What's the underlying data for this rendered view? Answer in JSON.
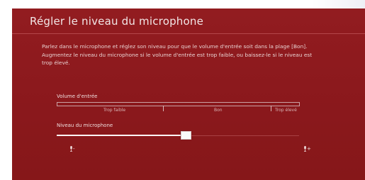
{
  "dialog": {
    "title": "Régler le niveau du microphone",
    "description": [
      "Parlez dans le microphone et réglez son niveau pour que le volume d'entrée soit dans la plage [Bon].",
      "Augmentez le niveau du microphone si le volume d'entrée est trop faible, ou baissez-le si le niveau est trop élevé."
    ]
  },
  "input_volume": {
    "label": "Volume d'entrée",
    "zones": [
      "Trop faible",
      "Bon",
      "Trop élevé"
    ]
  },
  "mic_level": {
    "label": "Niveau du microphone",
    "value_fraction": 0.53,
    "min_symbol": "-",
    "max_symbol": "+"
  },
  "colors": {
    "background": "#8e1a1e",
    "text": "#f2e6e6",
    "accent": "#ffffff"
  }
}
